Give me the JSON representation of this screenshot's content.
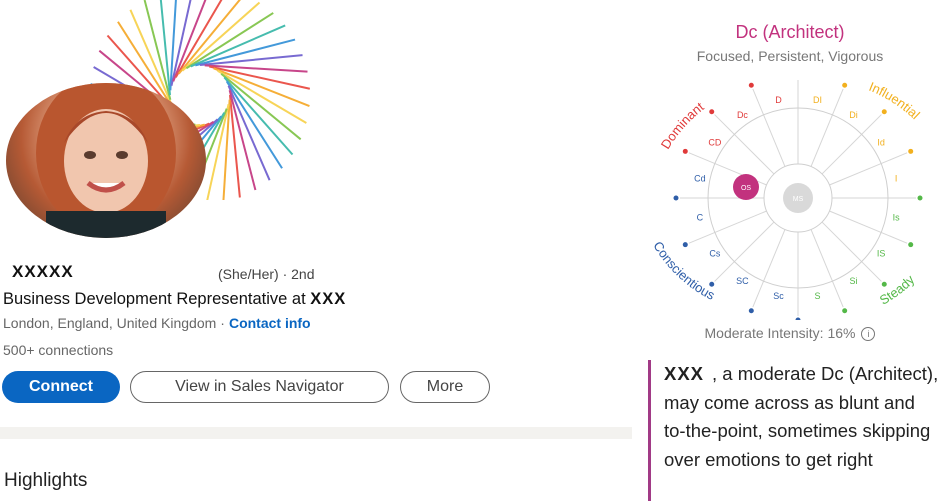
{
  "profile": {
    "name": "XXXXX",
    "pronouns_degree": "(She/Her) · 2nd",
    "headline_prefix": "Business Development Representative at",
    "headline_company": "XXX",
    "location": "London, England, United Kingdom",
    "separator": "·",
    "contact_link": "Contact info",
    "connections": "500+ connections"
  },
  "actions": {
    "connect": "Connect",
    "sales_navigator": "View in Sales Navigator",
    "more": "More"
  },
  "sections": {
    "highlights": "Highlights"
  },
  "disc": {
    "type_title": "Dc (Architect)",
    "traits": "Focused, Persistent, Vigorous",
    "quadrants": {
      "dominant": "Dominant",
      "influential": "Influential",
      "steady": "Steady",
      "conscientious": "Conscientious"
    },
    "segments": [
      "DI",
      "Di",
      "Id",
      "I",
      "Is",
      "IS",
      "Si",
      "S",
      "Sc",
      "SC",
      "Cs",
      "C",
      "Cd",
      "CD",
      "Dc",
      "D"
    ],
    "markers": {
      "os": "OS",
      "ms": "MS"
    },
    "intensity": "Moderate Intensity: 16%",
    "info_icon": "info-icon",
    "description_name": "XXX",
    "description_text": ", a moderate Dc (Architect), may come across as blunt and to-the-point, sometimes skipping over emotions to get right",
    "colors": {
      "accent": "#c2327e",
      "dominant": "#e03a3a",
      "influential": "#f2b01e",
      "steady": "#54b848",
      "conscientious": "#2f5ea8",
      "linkedin_blue": "#0a66c2"
    }
  }
}
